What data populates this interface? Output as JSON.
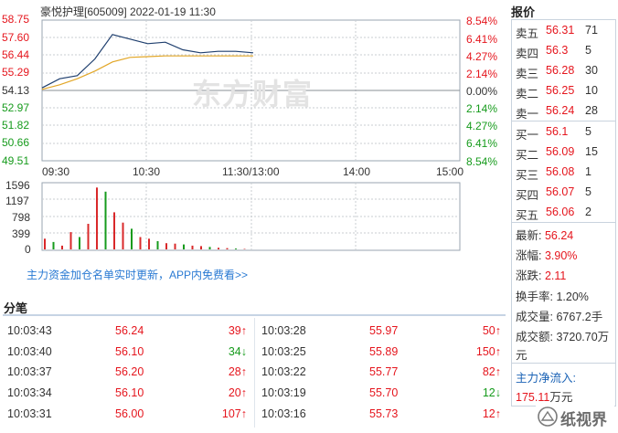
{
  "header": {
    "title": "豪悦护理[605009]  2022-01-19  11:30"
  },
  "watermark": "东方财富",
  "price_axis": {
    "left": [
      "58.75",
      "57.60",
      "56.44",
      "55.29",
      "54.13",
      "52.97",
      "51.82",
      "50.66",
      "49.51"
    ],
    "right": [
      "8.54%",
      "6.41%",
      "4.27%",
      "2.14%",
      "0.00%",
      "2.14%",
      "4.27%",
      "6.41%",
      "8.54%"
    ]
  },
  "time_axis": [
    "09:30",
    "10:30",
    "11:30/13:00",
    "14:00",
    "15:00"
  ],
  "volume_axis": [
    "1596",
    "1197",
    "798",
    "399",
    "0"
  ],
  "promo_text": "主力资金加仓名单实时更新，APP内免费看>>",
  "chart_data": {
    "type": "line",
    "title": "豪悦护理[605009]  2022-01-19  11:30",
    "xlabel": "",
    "ylabel": "",
    "ylim": [
      49.51,
      58.75
    ],
    "x": [
      "09:30",
      "09:40",
      "09:50",
      "10:00",
      "10:10",
      "10:20",
      "10:30",
      "10:40",
      "10:50",
      "11:00",
      "11:10",
      "11:20",
      "11:30"
    ],
    "series": [
      {
        "values": [
          54.3,
          54.9,
          55.1,
          56.2,
          57.8,
          57.5,
          57.2,
          57.3,
          56.8,
          56.6,
          56.7,
          56.7,
          56.6
        ]
      },
      {
        "values": [
          54.2,
          54.5,
          54.9,
          55.4,
          56.0,
          56.3,
          56.35,
          56.4,
          56.4,
          56.4,
          56.4,
          56.4,
          56.4
        ]
      }
    ],
    "volume": {
      "ylim": [
        0,
        1596
      ],
      "values": [
        260,
        180,
        90,
        420,
        300,
        620,
        1500,
        1400,
        900,
        650,
        500,
        300,
        260,
        200,
        150,
        140,
        120,
        90,
        80,
        60,
        40,
        30,
        20,
        10
      ]
    }
  },
  "quote": {
    "title": "报价",
    "asks": [
      {
        "label": "卖五",
        "price": "56.31",
        "vol": "71"
      },
      {
        "label": "卖四",
        "price": "56.3",
        "vol": "5"
      },
      {
        "label": "卖三",
        "price": "56.28",
        "vol": "30"
      },
      {
        "label": "卖二",
        "price": "56.25",
        "vol": "10"
      },
      {
        "label": "卖一",
        "price": "56.24",
        "vol": "28"
      }
    ],
    "bids": [
      {
        "label": "买一",
        "price": "56.1",
        "vol": "5"
      },
      {
        "label": "买二",
        "price": "56.09",
        "vol": "15"
      },
      {
        "label": "买三",
        "price": "56.08",
        "vol": "1"
      },
      {
        "label": "买四",
        "price": "56.07",
        "vol": "5"
      },
      {
        "label": "买五",
        "price": "56.06",
        "vol": "2"
      }
    ],
    "stats": {
      "latest_label": "最新:",
      "latest": "56.24",
      "chg_pct_label": "涨幅:",
      "chg_pct": "3.90%",
      "chg_label": "涨跌:",
      "chg": "2.11",
      "turnover_label": "换手率:",
      "turnover": "1.20%",
      "vol_label": "成交量:",
      "vol": "6767.2手",
      "amount_label": "成交额:",
      "amount": "3720.70万",
      "amount_unit": "元",
      "flow_label": "主力净流入:",
      "flow": "175.11",
      "flow_unit": "万元"
    }
  },
  "trades": {
    "title": "分笔",
    "left": [
      {
        "time": "10:03:43",
        "price": "56.24",
        "vol": "39↑",
        "dir": "up"
      },
      {
        "time": "10:03:40",
        "price": "56.10",
        "vol": "34↓",
        "dir": "down"
      },
      {
        "time": "10:03:37",
        "price": "56.20",
        "vol": "28↑",
        "dir": "up"
      },
      {
        "time": "10:03:34",
        "price": "56.10",
        "vol": "20↑",
        "dir": "up"
      },
      {
        "time": "10:03:31",
        "price": "56.00",
        "vol": "107↑",
        "dir": "up"
      }
    ],
    "right": [
      {
        "time": "10:03:28",
        "price": "55.97",
        "vol": "50↑",
        "dir": "up"
      },
      {
        "time": "10:03:25",
        "price": "55.89",
        "vol": "150↑",
        "dir": "up"
      },
      {
        "time": "10:03:22",
        "price": "55.77",
        "vol": "82↑",
        "dir": "up"
      },
      {
        "time": "10:03:19",
        "price": "55.70",
        "vol": "12↓",
        "dir": "down"
      },
      {
        "time": "10:03:16",
        "price": "55.73",
        "vol": "12↑",
        "dir": "up"
      }
    ]
  },
  "logo_text": "纸视界"
}
